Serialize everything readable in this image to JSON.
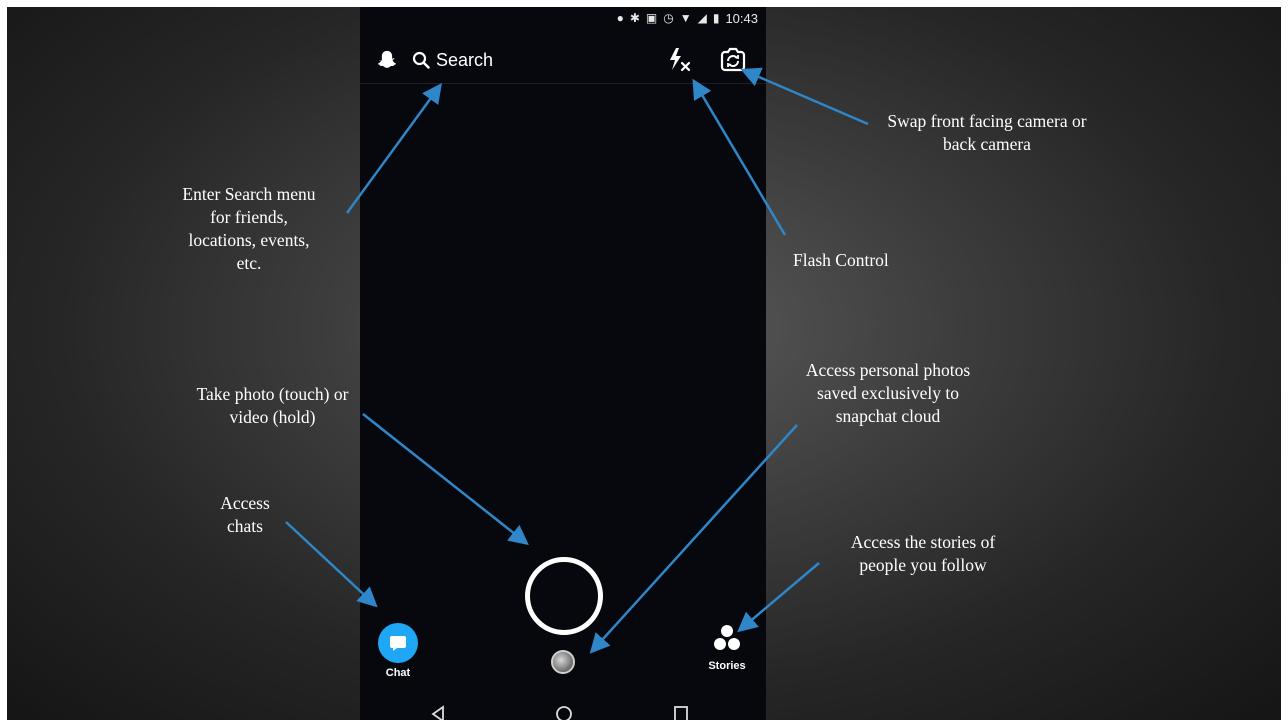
{
  "status_bar": {
    "time": "10:43",
    "icons": [
      "location-pin-icon",
      "bluetooth-icon",
      "vibrate-icon",
      "alarm-icon",
      "wifi-icon",
      "signal-icon",
      "battery-icon"
    ]
  },
  "top_bar": {
    "ghost_icon": "snapchat-ghost-icon",
    "search_label": "Search",
    "flash_icon": "flash-off-icon",
    "swap_icon": "swap-camera-icon"
  },
  "bottom_bar": {
    "chat_label": "Chat",
    "stories_label": "Stories"
  },
  "android_nav": [
    "back-icon",
    "home-icon",
    "recents-icon"
  ],
  "annotations": {
    "search": "Enter Search menu for friends, locations, events, etc.",
    "flash": "Flash Control",
    "swap": "Swap front facing camera or back camera",
    "capture": "Take photo (touch) or video (hold)",
    "memories": "Access personal photos saved exclusively to snapchat cloud",
    "chats": "Access chats",
    "stories": "Access the stories of people you follow"
  },
  "colors": {
    "accent_blue": "#1fa6f4",
    "arrow_blue": "#2f86c8",
    "phone_bg": "#06080d"
  }
}
